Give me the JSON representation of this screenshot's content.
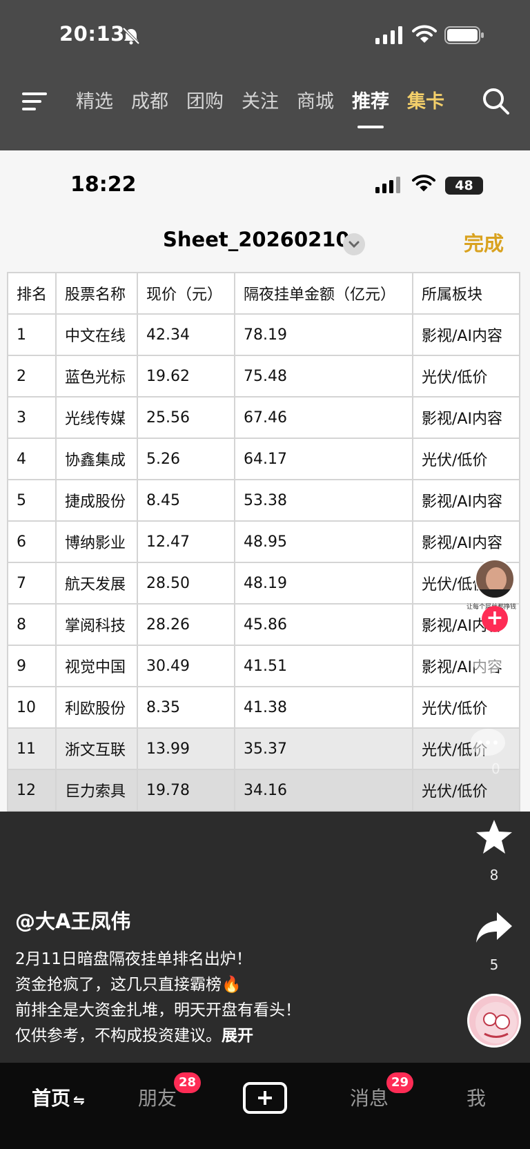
{
  "status": {
    "time": "20:13"
  },
  "topnav": {
    "tabs": [
      "精选",
      "成都",
      "团购",
      "关注",
      "商城",
      "推荐",
      "集卡"
    ],
    "active_tab": "推荐",
    "highlight_tab": "集卡"
  },
  "inner_status": {
    "time": "18:22",
    "battery": "48"
  },
  "sheet": {
    "title": "Sheet_20260210",
    "done_label": "完成",
    "headers": [
      "排名",
      "股票名称",
      "现价（元）",
      "隔夜挂单金额（亿元）",
      "所属板块"
    ],
    "rows": [
      [
        "1",
        "中文在线",
        "42.34",
        "78.19",
        "影视/AI内容"
      ],
      [
        "2",
        "蓝色光标",
        "19.62",
        "75.48",
        "光伏/低价"
      ],
      [
        "3",
        "光线传媒",
        "25.56",
        "67.46",
        "影视/AI内容"
      ],
      [
        "4",
        "协鑫集成",
        "5.26",
        "64.17",
        "光伏/低价"
      ],
      [
        "5",
        "捷成股份",
        "8.45",
        "53.38",
        "影视/AI内容"
      ],
      [
        "6",
        "博纳影业",
        "12.47",
        "48.95",
        "影视/AI内容"
      ],
      [
        "7",
        "航天发展",
        "28.50",
        "48.19",
        "光伏/低价"
      ],
      [
        "8",
        "掌阅科技",
        "28.26",
        "45.86",
        "影视/AI内容"
      ],
      [
        "9",
        "视觉中国",
        "30.49",
        "41.51",
        "影视/AI内容"
      ],
      [
        "10",
        "利欧股份",
        "8.35",
        "41.38",
        "光伏/低价"
      ],
      [
        "11",
        "浙文互联",
        "13.99",
        "35.37",
        "光伏/低价"
      ],
      [
        "12",
        "巨力索具",
        "19.78",
        "34.16",
        "光伏/低价"
      ]
    ]
  },
  "rail": {
    "avatar_caption": "让每个屌丝都挣钱",
    "follow_label": "+",
    "comment_count": "0",
    "favorite_count": "8",
    "share_count": "5"
  },
  "post": {
    "author": "@大A王凤伟",
    "lines": [
      "2月11日暗盘隔夜挂单排名出炉！",
      "资金抢疯了，这几只直接霸榜🔥",
      "前排全是大资金扎堆，明天开盘有看头！",
      "仅供参考，不构成投资建议。"
    ],
    "more_label": "展开"
  },
  "bottom_nav": {
    "home": "首页",
    "home_suffix": "⇋",
    "friends": "朋友",
    "friends_badge": "28",
    "messages": "消息",
    "messages_badge": "29",
    "me": "我"
  },
  "colors": {
    "accent_gold": "#f3cf6a",
    "done_gold": "#d9a21f",
    "badge_red": "#fe2c55"
  }
}
